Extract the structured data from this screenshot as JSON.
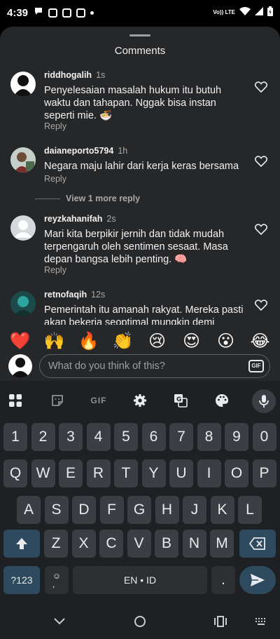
{
  "status_bar": {
    "time": "4:39",
    "network": "Vo)) LTE",
    "icons": [
      "chat-bubble-icon",
      "square-app-icon",
      "instagram-icon",
      "instagram-icon",
      "dot-icon",
      "wifi-icon",
      "signal-icon",
      "battery-icon"
    ]
  },
  "sheet": {
    "title": "Comments"
  },
  "comments": [
    {
      "user": "riddhogalih",
      "time": "1s",
      "text": "Penyelesaian masalah hukum itu butuh waktu dan tahapan. Nggak bisa instan seperti mie. 🍜",
      "reply": "Reply",
      "avatar": "dark-silhouette"
    },
    {
      "user": "daianeporto5794",
      "time": "1h",
      "text": "Negara maju lahir dari kerja keras bersama",
      "reply": "Reply",
      "avatar": "photo"
    },
    {
      "user": "reyzkahanifah",
      "time": "2s",
      "text": "Mari kita berpikir jernih dan tidak mudah terpengaruh oleh sentimen sesaat. Masa depan bangsa lebih penting. 🧠",
      "reply": "Reply",
      "avatar": "default-gray"
    },
    {
      "user": "retnofaqih",
      "time": "12s",
      "text": "Pemerintah itu amanah rakyat. Mereka pasti akan bekerja seoptimal mungkin demi",
      "reply": "",
      "avatar": "photo-teal"
    }
  ],
  "view_more": "View 1 more reply",
  "quick_emojis": [
    "❤️",
    "🙌",
    "🔥",
    "👏",
    "😢",
    "😍",
    "😮",
    "😂"
  ],
  "comment_input": {
    "placeholder": "What do you think of this?",
    "gif_label": "GIF"
  },
  "keyboard": {
    "toolbar": {
      "gif_label": "GIF",
      "icons": [
        "apps-grid-icon",
        "sticker-icon",
        "gif-icon",
        "settings-gear-icon",
        "translate-icon",
        "palette-icon",
        "mic-icon"
      ]
    },
    "rows": [
      [
        "1",
        "2",
        "3",
        "4",
        "5",
        "6",
        "7",
        "8",
        "9",
        "0"
      ],
      [
        "Q",
        "W",
        "E",
        "R",
        "T",
        "Y",
        "U",
        "I",
        "O",
        "P"
      ],
      [
        "A",
        "S",
        "D",
        "F",
        "G",
        "H",
        "J",
        "K",
        "L"
      ],
      [
        "Z",
        "X",
        "C",
        "V",
        "B",
        "N",
        "M"
      ]
    ],
    "symbols_key": "?123",
    "emoji_comma_key": "☺\n,",
    "space_label": "EN • ID",
    "period_key": "."
  },
  "colors": {
    "sheet_bg": "#262729",
    "keyboard_bg": "#1f2023",
    "key_bg": "#3c3e43",
    "accent_key": "#2e4a5e"
  }
}
